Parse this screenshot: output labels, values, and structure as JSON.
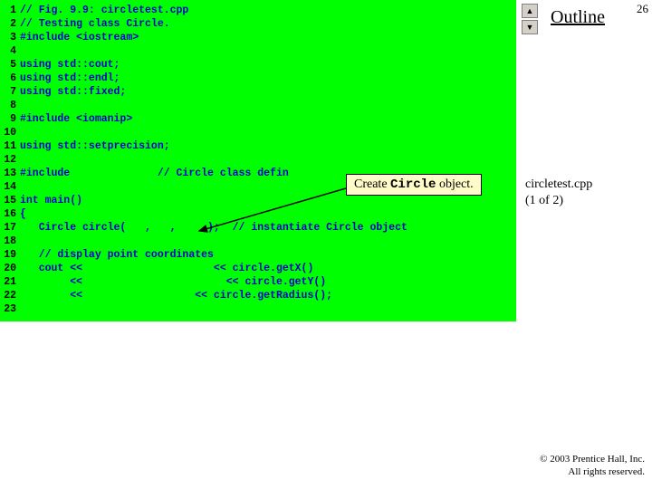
{
  "slide_number": "26",
  "outline_title": "Outline",
  "file_caption_line1": "circletest.cpp",
  "file_caption_line2": "(1 of 2)",
  "callout_prefix": "Create ",
  "callout_mono": "Circle",
  "callout_suffix": " object.",
  "footer_line1": "© 2003 Prentice Hall, Inc.",
  "footer_line2": "All rights reserved.",
  "code_lines": [
    {
      "n": "1",
      "t": "// Fig. 9.9: circletest.cpp"
    },
    {
      "n": "2",
      "t": "// Testing class Circle."
    },
    {
      "n": "3",
      "t": "#include <iostream>"
    },
    {
      "n": "4",
      "t": ""
    },
    {
      "n": "5",
      "t": "using std::cout;"
    },
    {
      "n": "6",
      "t": "using std::endl;"
    },
    {
      "n": "7",
      "t": "using std::fixed;"
    },
    {
      "n": "8",
      "t": ""
    },
    {
      "n": "9",
      "t": "#include <iomanip>"
    },
    {
      "n": "10",
      "t": ""
    },
    {
      "n": "11",
      "t": "using std::setprecision;"
    },
    {
      "n": "12",
      "t": ""
    },
    {
      "n": "13",
      "t": "#include              // Circle class defin"
    },
    {
      "n": "14",
      "t": ""
    },
    {
      "n": "15",
      "t": "int main()"
    },
    {
      "n": "16",
      "t": "{"
    },
    {
      "n": "17",
      "t": "   Circle circle(   ,   ,     );  // instantiate Circle object"
    },
    {
      "n": "18",
      "t": ""
    },
    {
      "n": "19",
      "t": "   // display point coordinates"
    },
    {
      "n": "20",
      "t": "   cout <<                     << circle.getX()"
    },
    {
      "n": "21",
      "t": "        <<                       << circle.getY()"
    },
    {
      "n": "22",
      "t": "        <<                  << circle.getRadius();"
    },
    {
      "n": "23",
      "t": ""
    }
  ],
  "arrow_up": "▲",
  "arrow_down": "▼"
}
